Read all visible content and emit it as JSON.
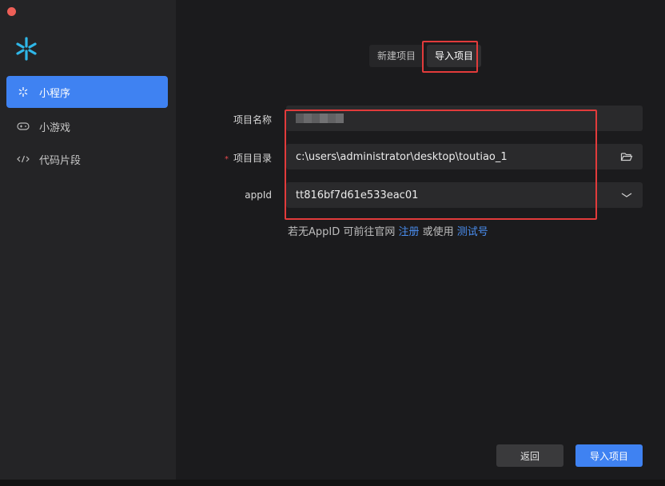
{
  "sidebar": {
    "logo_icon": "sparkle-logo-icon",
    "items": [
      {
        "label": "小程序",
        "icon": "sparkle-icon",
        "active": true
      },
      {
        "label": "小游戏",
        "icon": "gamepad-icon",
        "active": false
      },
      {
        "label": "代码片段",
        "icon": "code-icon",
        "active": false
      }
    ]
  },
  "tabs": [
    {
      "label": "新建项目",
      "active": false
    },
    {
      "label": "导入项目",
      "active": true
    }
  ],
  "form": {
    "name_label": "项目名称",
    "name_value_blurred": true,
    "dir_label": "项目目录",
    "dir_required_mark": "*",
    "dir_value": "c:\\users\\administrator\\desktop\\toutiao_1",
    "dir_icon": "folder-open-icon",
    "appid_label": "appId",
    "appid_value": "tt816bf7d61e533eac01",
    "appid_icon": "chevron-down-icon"
  },
  "help": {
    "prefix": "若无AppID 可前往官网 ",
    "register_link": "注册",
    "middle": " 或使用 ",
    "test_link": "测试号"
  },
  "buttons": {
    "back": "返回",
    "import": "导入项目"
  },
  "colors": {
    "accent": "#3f82f2",
    "highlight": "#e23b3b",
    "link": "#4a8ef0"
  }
}
